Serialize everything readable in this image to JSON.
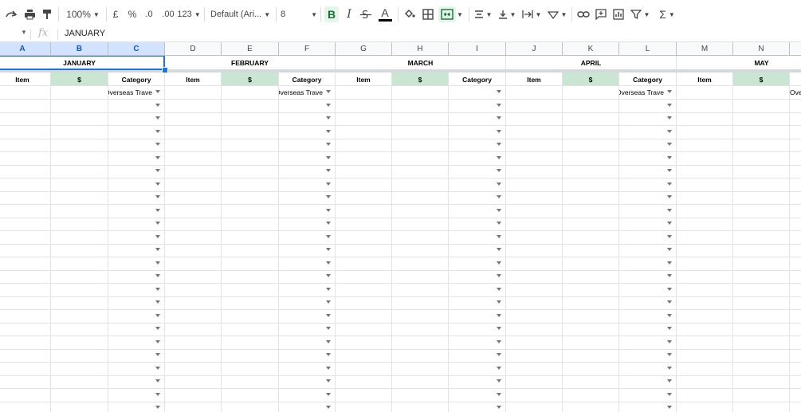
{
  "toolbar": {
    "zoom": "100%",
    "currency": "£",
    "percent": "%",
    "decrease_decimals": ".0",
    "increase_decimals": ".00",
    "more_formats": "123",
    "font_family": "Default (Ari...",
    "font_size": "8",
    "bold": "B",
    "italic": "I",
    "text_color_letter": "A",
    "sigma": "Σ"
  },
  "formula_bar": {
    "value": "JANUARY"
  },
  "columns": [
    "A",
    "B",
    "C",
    "D",
    "E",
    "F",
    "G",
    "H",
    "I",
    "J",
    "K",
    "L",
    "M",
    "N"
  ],
  "months": [
    "JANUARY",
    "FEBRUARY",
    "MARCH",
    "APRIL",
    "MAY"
  ],
  "sub_headers": {
    "item": "Item",
    "amount": "$",
    "category": "Category"
  },
  "first_row_categories": [
    "Overseas Trave",
    "Overseas Trave",
    "",
    "Overseas Trave",
    "Over"
  ],
  "colors": {
    "amount_header_bg": "#c9e6d3",
    "selection": "#1a73e8"
  }
}
